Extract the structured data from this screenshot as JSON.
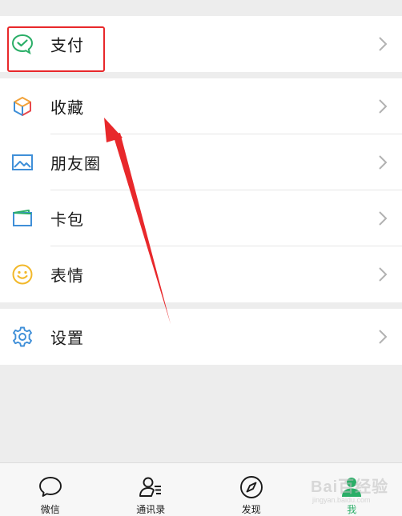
{
  "menu": {
    "pay": {
      "label": "支付",
      "icon": "wechat-pay-icon"
    },
    "favorites": {
      "label": "收藏",
      "icon": "cube-icon"
    },
    "moments": {
      "label": "朋友圈",
      "icon": "image-icon"
    },
    "cards": {
      "label": "卡包",
      "icon": "card-wallet-icon"
    },
    "stickers": {
      "label": "表情",
      "icon": "smiley-icon"
    },
    "settings": {
      "label": "设置",
      "icon": "gear-icon"
    }
  },
  "tabs": [
    {
      "label": "微信",
      "icon": "chat-bubble-icon",
      "active": false
    },
    {
      "label": "通讯录",
      "icon": "contacts-icon",
      "active": false
    },
    {
      "label": "发现",
      "icon": "compass-icon",
      "active": false
    },
    {
      "label": "我",
      "icon": "me-icon",
      "active": true
    }
  ],
  "watermark": {
    "text": "Bai百经验",
    "sub": "jingyan.baidu.com"
  },
  "colors": {
    "accent": "#2aae67",
    "highlight": "#e8282b",
    "background": "#ededed"
  }
}
